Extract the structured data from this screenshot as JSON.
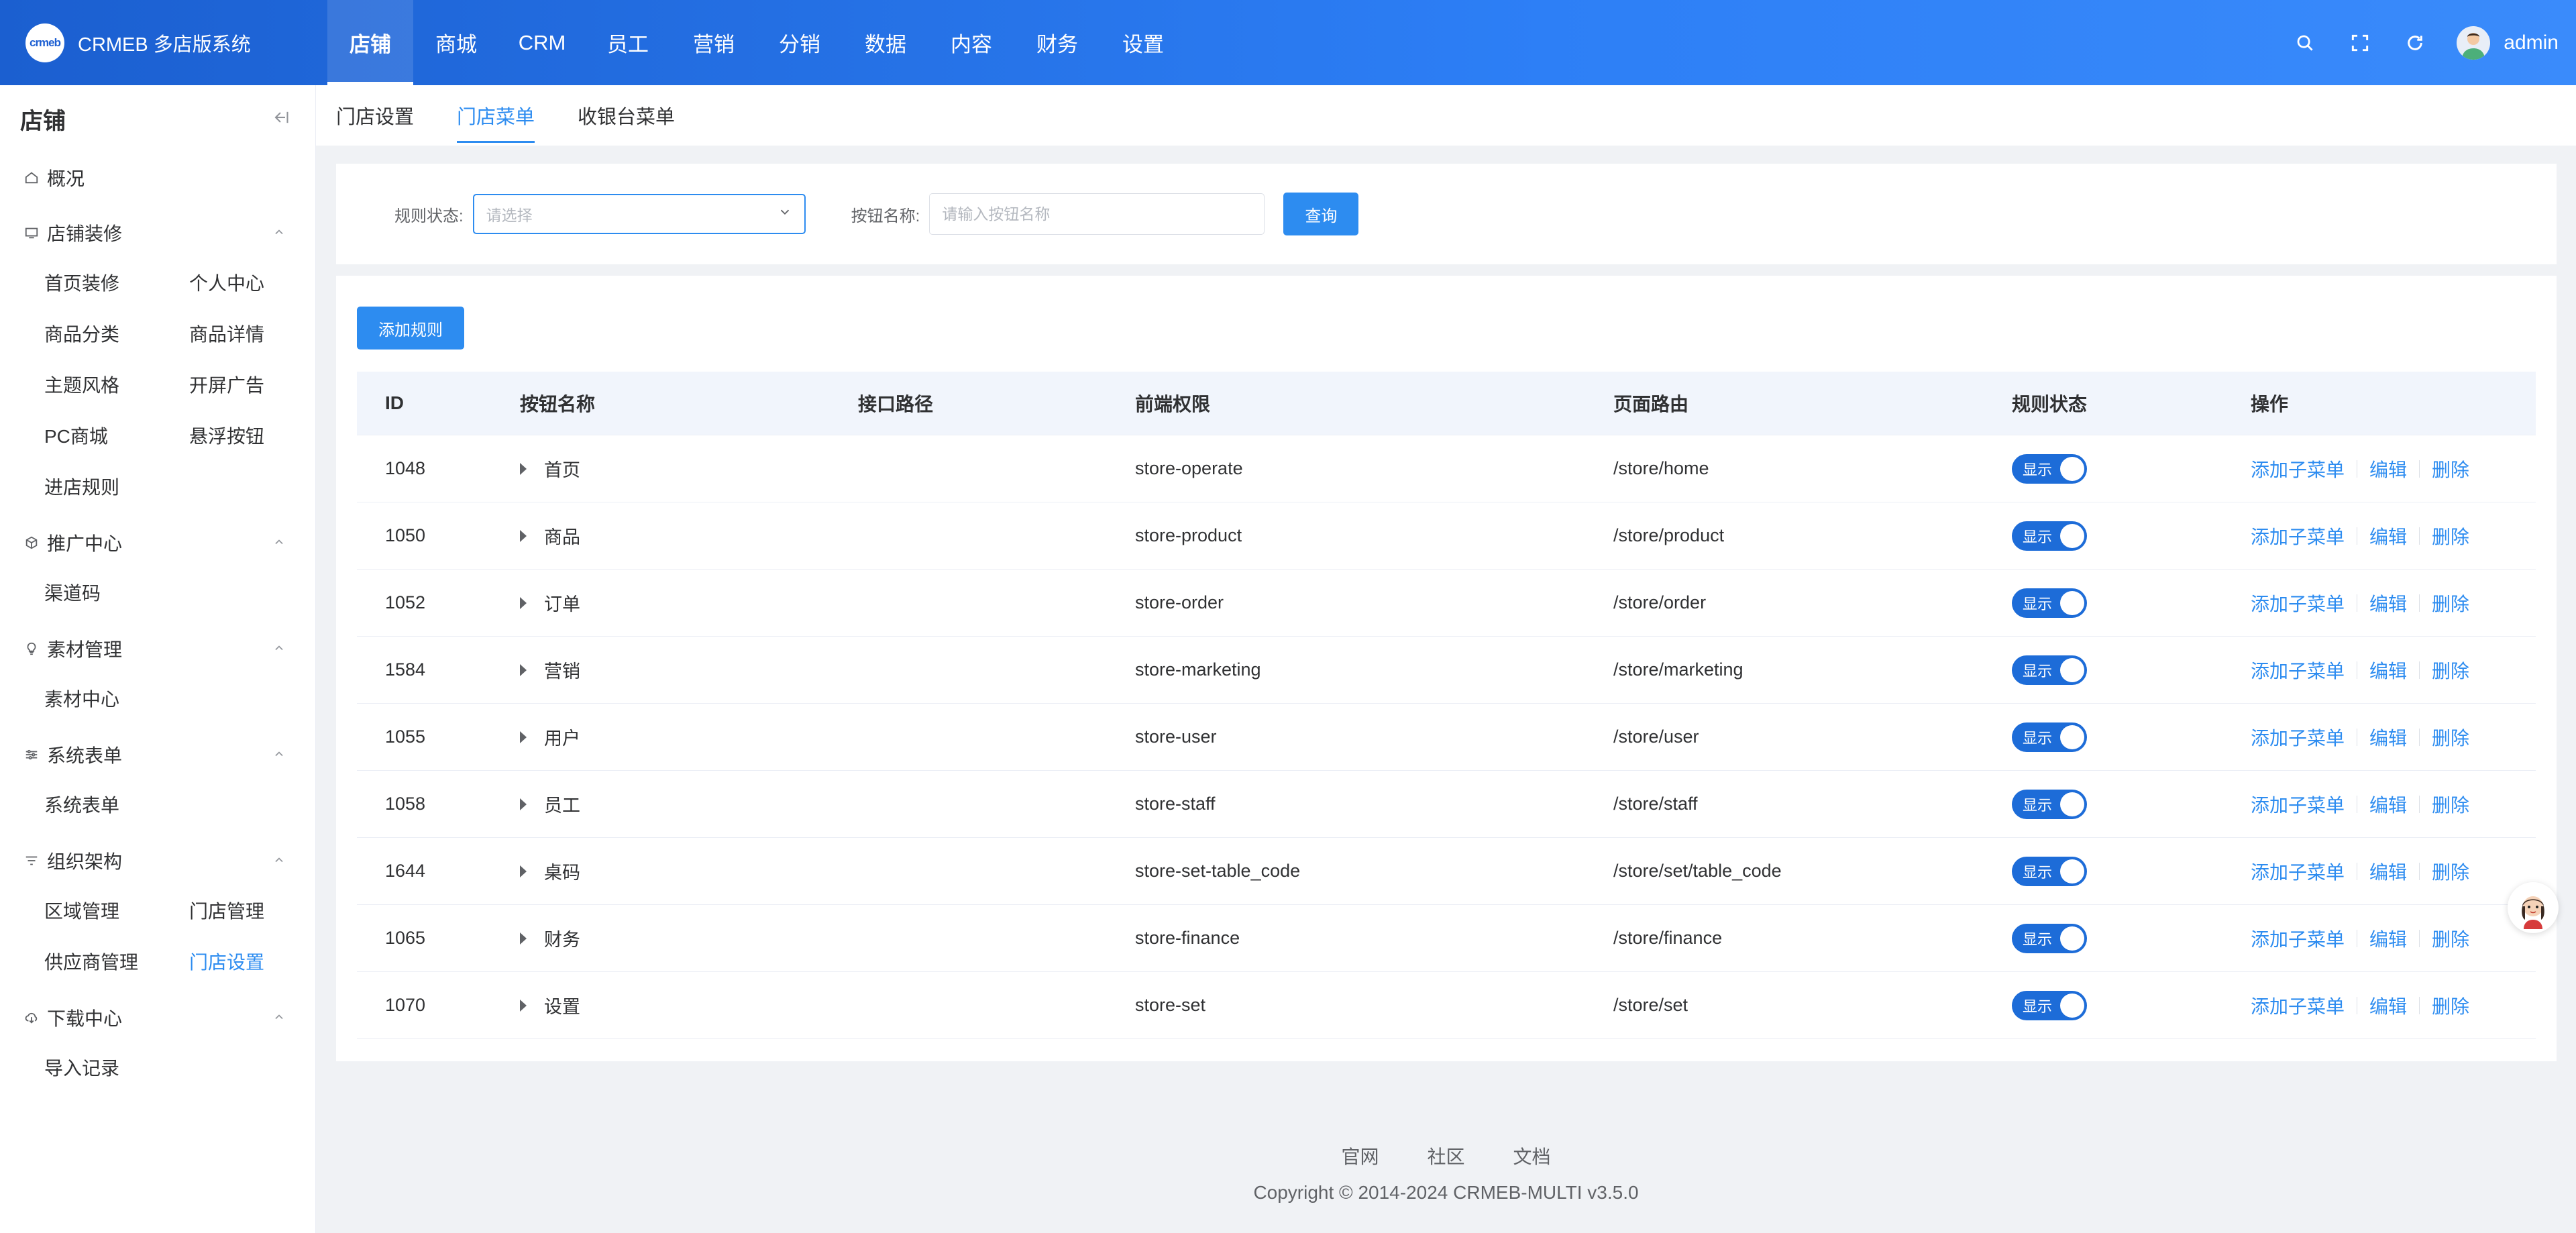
{
  "brand": {
    "logo_text": "crmeb",
    "name": "CRMEB 多店版系统"
  },
  "topnav": [
    {
      "label": "店铺",
      "active": true
    },
    {
      "label": "商城"
    },
    {
      "label": "CRM"
    },
    {
      "label": "员工"
    },
    {
      "label": "营销"
    },
    {
      "label": "分销"
    },
    {
      "label": "数据"
    },
    {
      "label": "内容"
    },
    {
      "label": "财务"
    },
    {
      "label": "设置"
    }
  ],
  "header_right": {
    "icons": [
      "search-icon",
      "fullscreen-icon",
      "refresh-icon"
    ],
    "username": "admin"
  },
  "sidebar": {
    "title": "店铺",
    "overview": "概况",
    "groups": [
      {
        "label": "店铺装修",
        "icon": "monitor-icon",
        "items": [
          "首页装修",
          "个人中心",
          "商品分类",
          "商品详情",
          "主题风格",
          "开屏广告",
          "PC商城",
          "悬浮按钮",
          "进店规则"
        ]
      },
      {
        "label": "推广中心",
        "icon": "cube-icon",
        "items": [
          "渠道码"
        ]
      },
      {
        "label": "素材管理",
        "icon": "bulb-icon",
        "items": [
          "素材中心"
        ]
      },
      {
        "label": "系统表单",
        "icon": "sliders-icon",
        "items": [
          "系统表单"
        ]
      },
      {
        "label": "组织架构",
        "icon": "filter-icon",
        "items": [
          "区域管理",
          "门店管理",
          "供应商管理",
          "门店设置"
        ],
        "active_item": "门店设置"
      },
      {
        "label": "下载中心",
        "icon": "download-cloud-icon",
        "items": [
          "导入记录"
        ]
      }
    ]
  },
  "tabs": [
    {
      "label": "门店设置"
    },
    {
      "label": "门店菜单",
      "active": true
    },
    {
      "label": "收银台菜单"
    }
  ],
  "filter": {
    "status_label": "规则状态:",
    "status_placeholder": "请选择",
    "name_label": "按钮名称:",
    "name_placeholder": "请输入按钮名称",
    "query_button": "查询"
  },
  "add_button": "添加规则",
  "table": {
    "headers": [
      "ID",
      "按钮名称",
      "接口路径",
      "前端权限",
      "页面路由",
      "规则状态",
      "操作"
    ],
    "rows": [
      {
        "id": "1048",
        "name": "首页",
        "path": "",
        "perm": "store-operate",
        "route": "/store/home",
        "status": "显示"
      },
      {
        "id": "1050",
        "name": "商品",
        "path": "",
        "perm": "store-product",
        "route": "/store/product",
        "status": "显示"
      },
      {
        "id": "1052",
        "name": "订单",
        "path": "",
        "perm": "store-order",
        "route": "/store/order",
        "status": "显示"
      },
      {
        "id": "1584",
        "name": "营销",
        "path": "",
        "perm": "store-marketing",
        "route": "/store/marketing",
        "status": "显示"
      },
      {
        "id": "1055",
        "name": "用户",
        "path": "",
        "perm": "store-user",
        "route": "/store/user",
        "status": "显示"
      },
      {
        "id": "1058",
        "name": "员工",
        "path": "",
        "perm": "store-staff",
        "route": "/store/staff",
        "status": "显示"
      },
      {
        "id": "1644",
        "name": "桌码",
        "path": "",
        "perm": "store-set-table_code",
        "route": "/store/set/table_code",
        "status": "显示"
      },
      {
        "id": "1065",
        "name": "财务",
        "path": "",
        "perm": "store-finance",
        "route": "/store/finance",
        "status": "显示"
      },
      {
        "id": "1070",
        "name": "设置",
        "path": "",
        "perm": "store-set",
        "route": "/store/set",
        "status": "显示"
      }
    ],
    "ops": [
      "添加子菜单",
      "编辑",
      "删除"
    ]
  },
  "footer": {
    "links": [
      "官网",
      "社区",
      "文档"
    ],
    "copyright": "Copyright © 2014-2024 CRMEB-MULTI v3.5.0"
  },
  "colors": {
    "primary": "#2d8cf0",
    "topbar": "#1b5fd0",
    "toggle_on": "#1d6cd8"
  }
}
